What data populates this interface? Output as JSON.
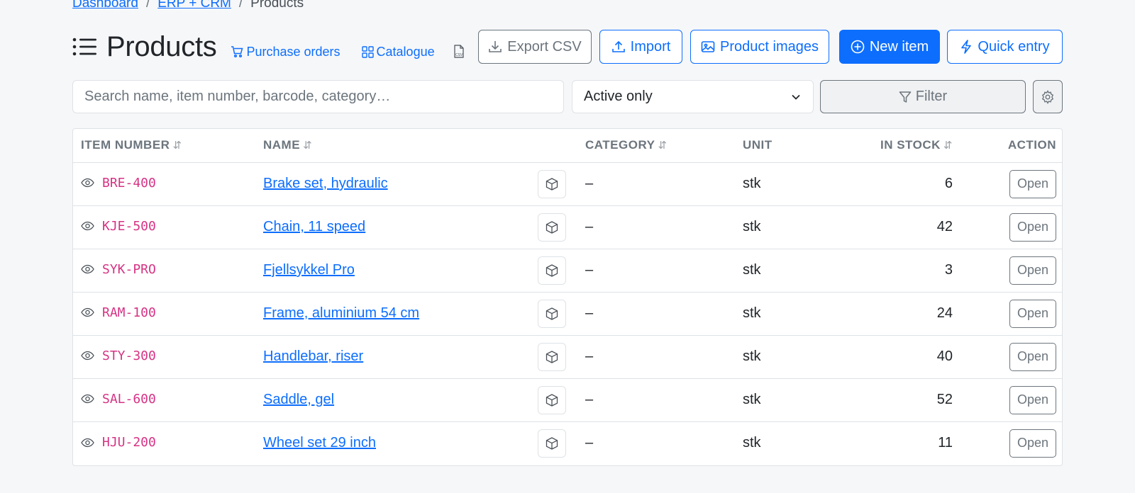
{
  "breadcrumb": {
    "items": [
      "Dashboard",
      "ERP + CRM"
    ],
    "separator": "/",
    "current": "Products"
  },
  "header": {
    "title": "Products",
    "links": {
      "purchase_orders": "Purchase orders",
      "catalogue": "Catalogue"
    },
    "buttons": {
      "export_csv": "Export CSV",
      "import": "Import",
      "product_images": "Product images",
      "new_item": "New item",
      "quick_entry": "Quick entry"
    }
  },
  "filters": {
    "search_placeholder": "Search name, item number, barcode, category…",
    "status_selected": "Active only",
    "filter_label": "Filter"
  },
  "table": {
    "columns": {
      "item_number": "ITEM NUMBER",
      "name": "NAME",
      "category": "CATEGORY",
      "unit": "UNIT",
      "in_stock": "IN STOCK",
      "action": "ACTION"
    },
    "rows": [
      {
        "item_number": "BRE-400",
        "name": "Brake set, hydraulic",
        "category": "–",
        "unit": "stk",
        "in_stock": "6",
        "action": "Open"
      },
      {
        "item_number": "KJE-500",
        "name": "Chain, 11 speed",
        "category": "–",
        "unit": "stk",
        "in_stock": "42",
        "action": "Open"
      },
      {
        "item_number": "SYK-PRO",
        "name": "Fjellsykkel Pro",
        "category": "–",
        "unit": "stk",
        "in_stock": "3",
        "action": "Open"
      },
      {
        "item_number": "RAM-100",
        "name": "Frame, aluminium 54 cm",
        "category": "–",
        "unit": "stk",
        "in_stock": "24",
        "action": "Open"
      },
      {
        "item_number": "STY-300",
        "name": "Handlebar, riser",
        "category": "–",
        "unit": "stk",
        "in_stock": "40",
        "action": "Open"
      },
      {
        "item_number": "SAL-600",
        "name": "Saddle, gel",
        "category": "–",
        "unit": "stk",
        "in_stock": "52",
        "action": "Open"
      },
      {
        "item_number": "HJU-200",
        "name": "Wheel set 29 inch",
        "category": "–",
        "unit": "stk",
        "in_stock": "11",
        "action": "Open"
      }
    ]
  },
  "icons": [
    "list-icon",
    "cart-icon",
    "grid-icon",
    "csv-file-icon",
    "download-icon",
    "upload-icon",
    "image-icon",
    "plus-circle-icon",
    "lightning-icon",
    "chevron-down-icon",
    "funnel-icon",
    "gear-icon",
    "sort-icon",
    "eye-icon",
    "box-icon"
  ],
  "colors": {
    "primary": "#0d6efd",
    "secondary": "#6c757d",
    "item_number": "#d63384",
    "background": "#f6f7f9"
  }
}
